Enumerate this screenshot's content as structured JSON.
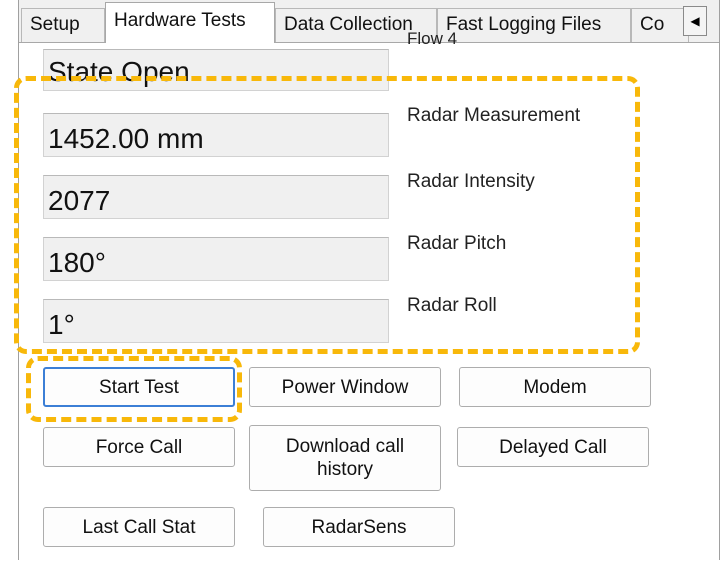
{
  "tabs": [
    {
      "label": "Setup"
    },
    {
      "label": "Hardware Tests",
      "active": true
    },
    {
      "label": "Data Collection"
    },
    {
      "label": "Fast Logging Files"
    },
    {
      "label": "Co"
    }
  ],
  "tab_scroll_icon": "left-arrow-icon",
  "fields": [
    {
      "label": "Flow 4",
      "value": "State Open"
    },
    {
      "label": "Radar Measurement",
      "value": "1452.00 mm"
    },
    {
      "label": "Radar Intensity",
      "value": "2077"
    },
    {
      "label": "Radar Pitch",
      "value": "180°"
    },
    {
      "label": "Radar Roll",
      "value": "1°"
    }
  ],
  "buttons": {
    "start_test": "Start Test",
    "power_window": "Power Window",
    "modem": "Modem",
    "force_call": "Force Call",
    "download_call_history": "Download call history",
    "delayed_call": "Delayed Call",
    "last_call_stat": "Last Call Stat",
    "radarsens": "RadarSens"
  },
  "highlight_color": "#f8b80a"
}
